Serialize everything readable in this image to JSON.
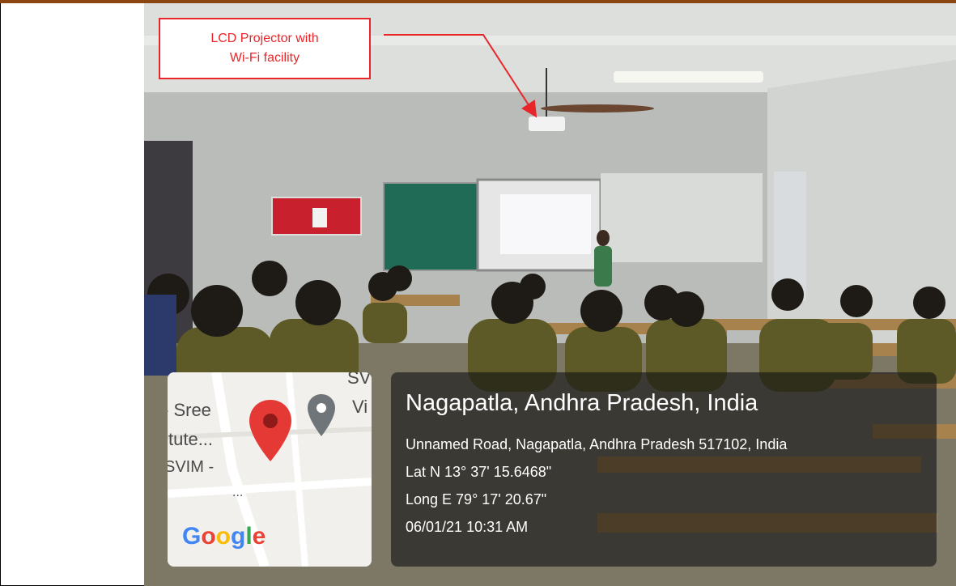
{
  "callout": {
    "line1": "LCD Projector with",
    "line2": "Wi-Fi facility",
    "color": "#e8262a"
  },
  "map": {
    "labels": [
      "- Sree",
      "titute...",
      "SVIM -",
      "...",
      "SV",
      "Vi"
    ],
    "pin_icon": "map-pin-icon",
    "place_icon": "place-marker-icon",
    "brand": [
      "G",
      "o",
      "o",
      "g",
      "l",
      "e"
    ]
  },
  "geotag": {
    "place": "Nagapatla, Andhra Pradesh, India",
    "address": "Unnamed Road, Nagapatla, Andhra Pradesh 517102, India",
    "lat": "Lat N 13° 37' 15.6468\"",
    "long": "Long E 79° 17' 20.67\"",
    "datetime": "06/01/21 10:31 AM"
  }
}
